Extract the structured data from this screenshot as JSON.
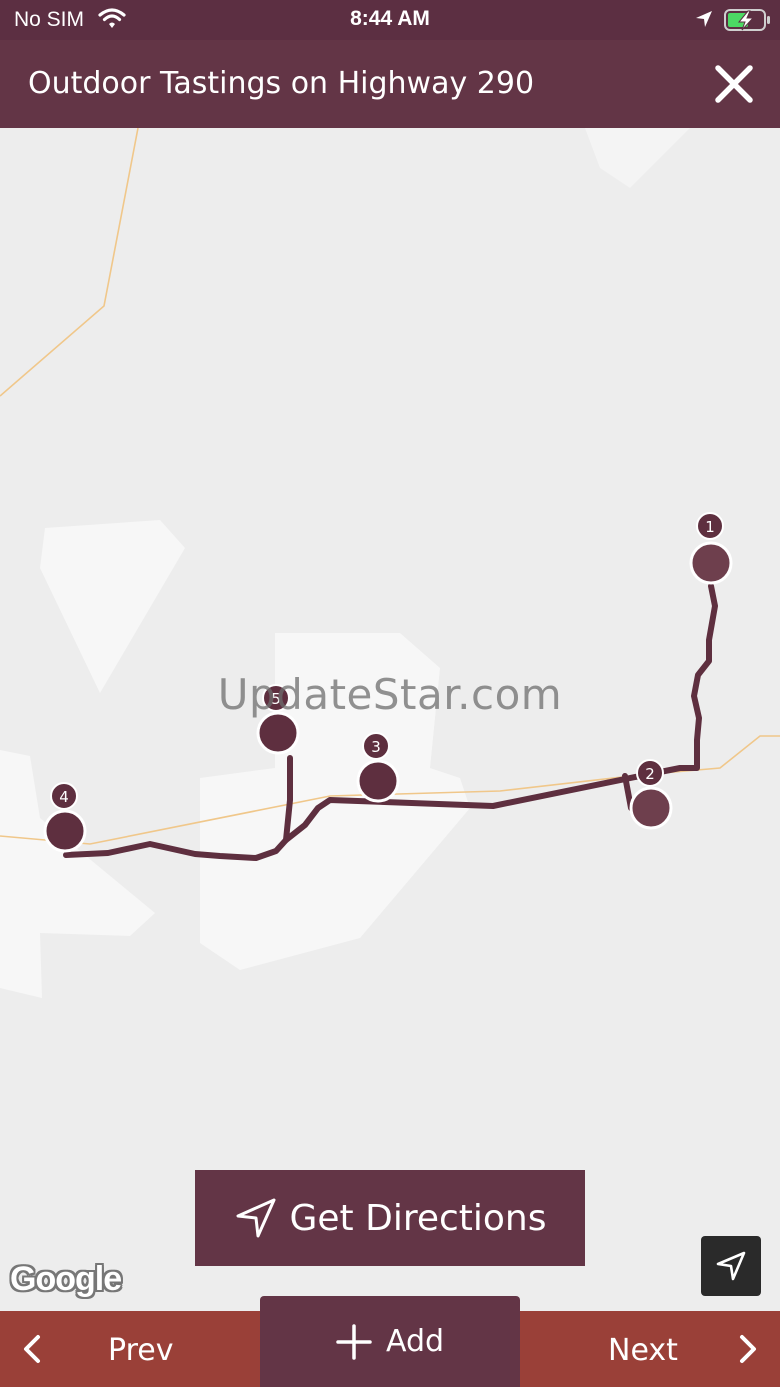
{
  "status_bar": {
    "carrier": "No SIM",
    "time": "8:44 AM"
  },
  "header": {
    "title": "Outdoor Tastings on Highway 290",
    "close_icon": "close-icon"
  },
  "map": {
    "watermark": "UpdateStar.com",
    "route_color": "#5e2f3f",
    "markers": [
      {
        "label": "1"
      },
      {
        "label": "2"
      },
      {
        "label": "3"
      },
      {
        "label": "4"
      },
      {
        "label": "5"
      }
    ],
    "provider_logo": "Google"
  },
  "actions": {
    "directions_label": "Get Directions",
    "directions_icon": "navigation-arrow-icon",
    "locate_icon": "location-arrow-icon"
  },
  "bottom_nav": {
    "prev_label": "Prev",
    "add_label": "Add",
    "next_label": "Next"
  },
  "colors": {
    "header_bg": "#633546",
    "status_bg": "#5c2f42",
    "nav_bg": "#9a4038",
    "map_bg": "#ededed"
  }
}
